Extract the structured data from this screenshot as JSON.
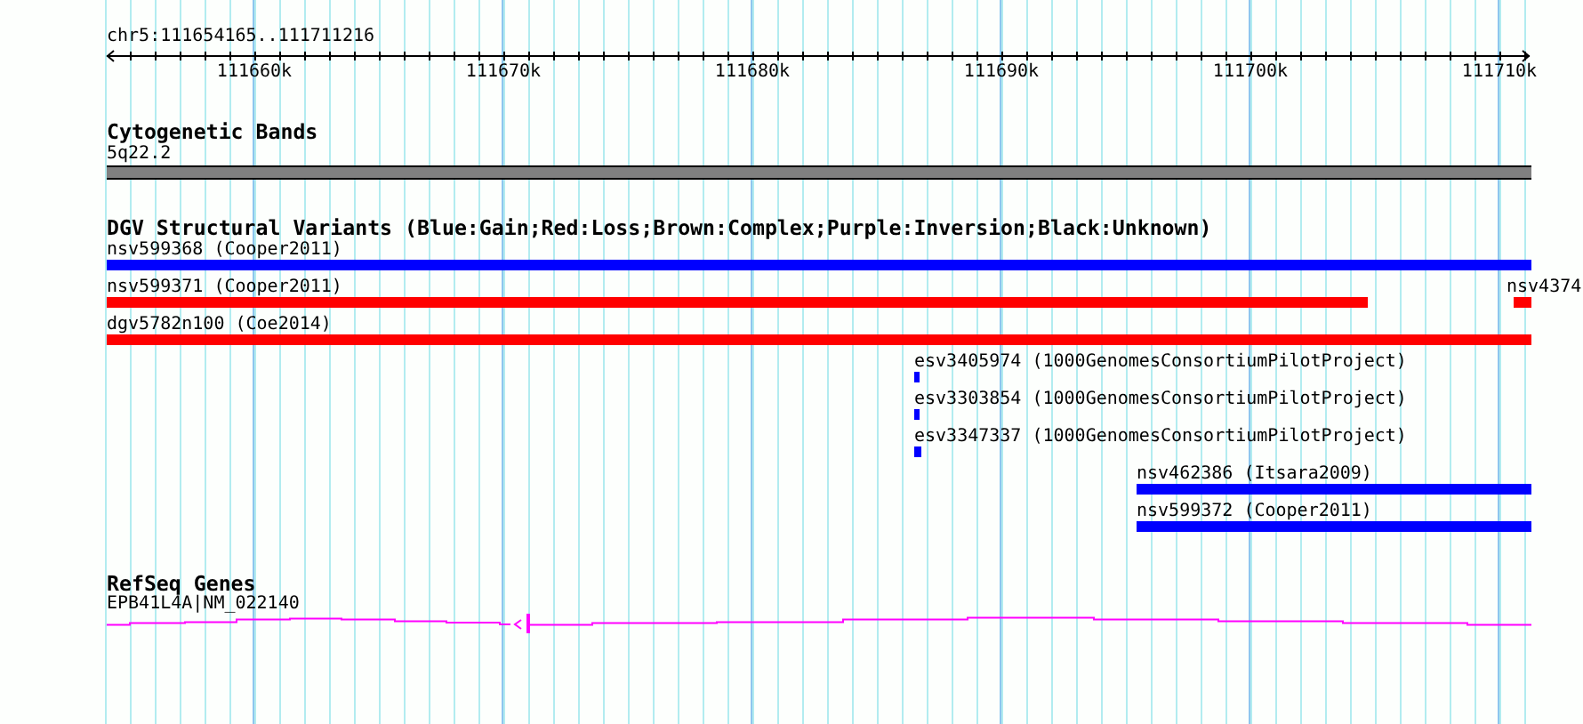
{
  "ruler": {
    "position": "chr5:111654165..111711216",
    "ticks": [
      "111660k",
      "111670k",
      "111680k",
      "111690k",
      "111700k",
      "111710k"
    ]
  },
  "tracks": [
    {
      "kind": "bands",
      "title": "Cytogenetic Bands",
      "features": [
        {
          "label": "5q22.2"
        }
      ]
    },
    {
      "kind": "variants",
      "title": "DGV Structural Variants (Blue:Gain;Red:Loss;Brown:Complex;Purple:Inversion;Black:Unknown)",
      "features": [
        {
          "label": "nsv599368 (Cooper2011)",
          "color": "#0000ff"
        },
        {
          "label": "nsv599371 (Cooper2011)",
          "color": "#ff0000"
        },
        {
          "label": "nsv4374",
          "color": "#ff0000"
        },
        {
          "label": "dgv5782n100 (Coe2014)",
          "color": "#ff0000"
        },
        {
          "label": "esv3405974 (1000GenomesConsortiumPilotProject)",
          "color": "#0000ff"
        },
        {
          "label": "esv3303854 (1000GenomesConsortiumPilotProject)",
          "color": "#0000ff"
        },
        {
          "label": "esv3347337 (1000GenomesConsortiumPilotProject)",
          "color": "#0000ff"
        },
        {
          "label": "nsv462386 (Itsara2009)",
          "color": "#0000ff"
        },
        {
          "label": "nsv599372 (Cooper2011)",
          "color": "#0000ff"
        }
      ]
    },
    {
      "kind": "genes",
      "title": "RefSeq Genes",
      "features": [
        {
          "label": "EPB41L4A|NM_022140"
        }
      ]
    }
  ]
}
